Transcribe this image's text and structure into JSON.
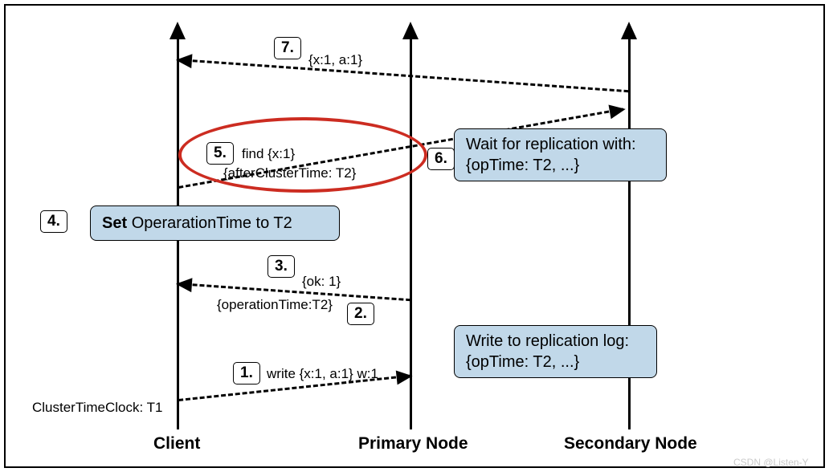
{
  "actors": {
    "client": "Client",
    "primary": "Primary Node",
    "secondary": "Secondary Node"
  },
  "steps": {
    "s1": "1.",
    "s2": "2.",
    "s3": "3.",
    "s4": "4.",
    "s5": "5.",
    "s6": "6.",
    "s7": "7."
  },
  "messages": {
    "m1": "write {x:1, a:1} w:1",
    "m2": "{operationTime:T2}",
    "m3": "{ok: 1}",
    "m5_line1": "find {x:1}",
    "m5_line2": "{afterClusterTime: T2}",
    "m7": "{x:1, a:1}"
  },
  "boxes": {
    "b4": "OperarationTime to T2",
    "b4_prefix": "Set ",
    "b6_line1": "Wait for  replication with:",
    "b6_line2": "{opTime: T2, ...}",
    "bwrite_line1": "Write to replication log:",
    "bwrite_line2": "{opTime: T2, ...}"
  },
  "labels": {
    "clustertime": "ClusterTimeClock: T1"
  },
  "watermark": "CSDN @Listen-Y"
}
